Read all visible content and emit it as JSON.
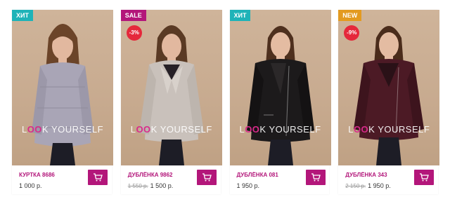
{
  "products": [
    {
      "badge": "ХИТ",
      "badge_color": "#1fb3b8",
      "discount": "",
      "name": "КУРТКА 8686",
      "old_price": "",
      "price": "1 000 р.",
      "jacket_color": "#a9a5b6",
      "jacket_type": "puffer"
    },
    {
      "badge": "SALE",
      "badge_color": "#b3167a",
      "discount": "-3%",
      "name": "ДУБЛЁНКА 9862",
      "old_price": "1 550 р.",
      "price": "1 500 р.",
      "jacket_color": "#c9c1bb",
      "jacket_type": "sheepskin"
    },
    {
      "badge": "ХИТ",
      "badge_color": "#1fb3b8",
      "discount": "",
      "name": "ДУБЛЁНКА 081",
      "old_price": "",
      "price": "1 950 р.",
      "jacket_color": "#1c1a1b",
      "jacket_type": "biker"
    },
    {
      "badge": "NEW",
      "badge_color": "#e39a20",
      "discount": "-9%",
      "name": "ДУБЛЁНКА 343",
      "old_price": "2 150 р.",
      "price": "1 950 р.",
      "jacket_color": "#4c1a25",
      "jacket_type": "biker"
    }
  ],
  "watermark": {
    "prefix": "L",
    "oo": "OO",
    "suffix": "K YOURSELF"
  },
  "icons": {
    "cart": "cart-icon"
  },
  "colors": {
    "accent": "#b3167a",
    "hit": "#1fb3b8",
    "new": "#e39a20",
    "discount": "#e5283b"
  }
}
